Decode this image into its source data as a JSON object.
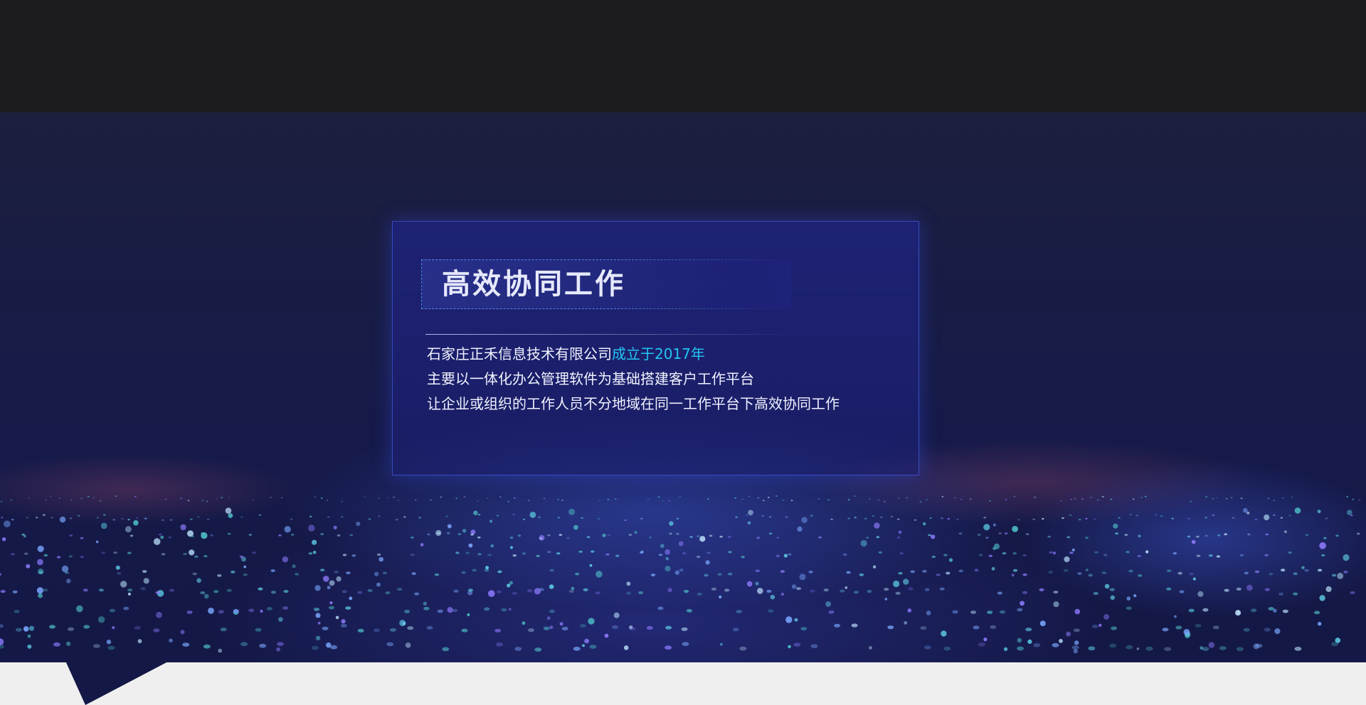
{
  "intro": {
    "title": "高效协同工作",
    "line1_prefix": "石家庄正禾信息技术有限公司",
    "line1_highlight": "成立于2017年",
    "line2": "主要以一体化办公管理软件为基础搭建客户工作平台",
    "line3": "让企业或组织的工作人员不分地域在同一工作平台下高效协同工作"
  },
  "colors": {
    "top_bar": "#1c1b20",
    "hero_background": "#161a4a",
    "card_background": "#1e2278",
    "highlight_text": "#21c6f2",
    "page_background": "#efefef"
  },
  "visual": {
    "background_art": "data-city-light-columns"
  }
}
